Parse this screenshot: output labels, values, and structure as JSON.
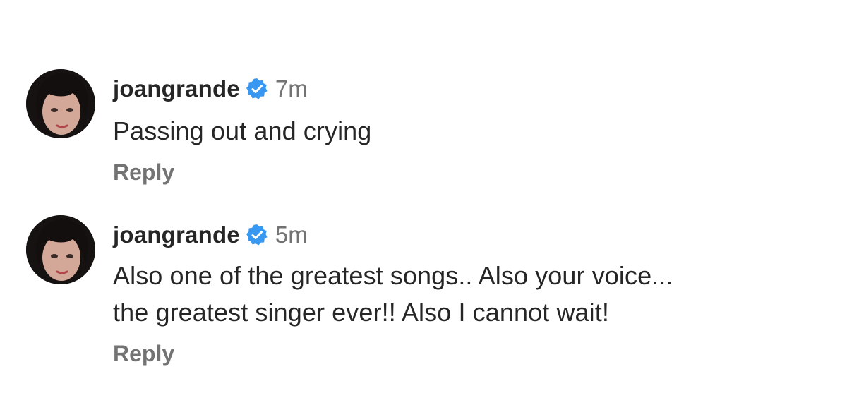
{
  "comments": [
    {
      "username": "joangrande",
      "verified": true,
      "time": "7m",
      "lines": [
        "Passing out and crying"
      ],
      "reply_label": "Reply"
    },
    {
      "username": "joangrande",
      "verified": true,
      "time": "5m",
      "lines": [
        "Also one of the greatest songs.. Also your voice...",
        "the greatest singer ever!! Also I cannot wait!"
      ],
      "reply_label": "Reply"
    }
  ],
  "icons": {
    "verified": "verified-badge-icon",
    "avatar": "profile-avatar"
  },
  "colors": {
    "text_primary": "#262626",
    "text_secondary": "#737373",
    "verified_blue": "#3897F0",
    "background": "#ffffff"
  }
}
